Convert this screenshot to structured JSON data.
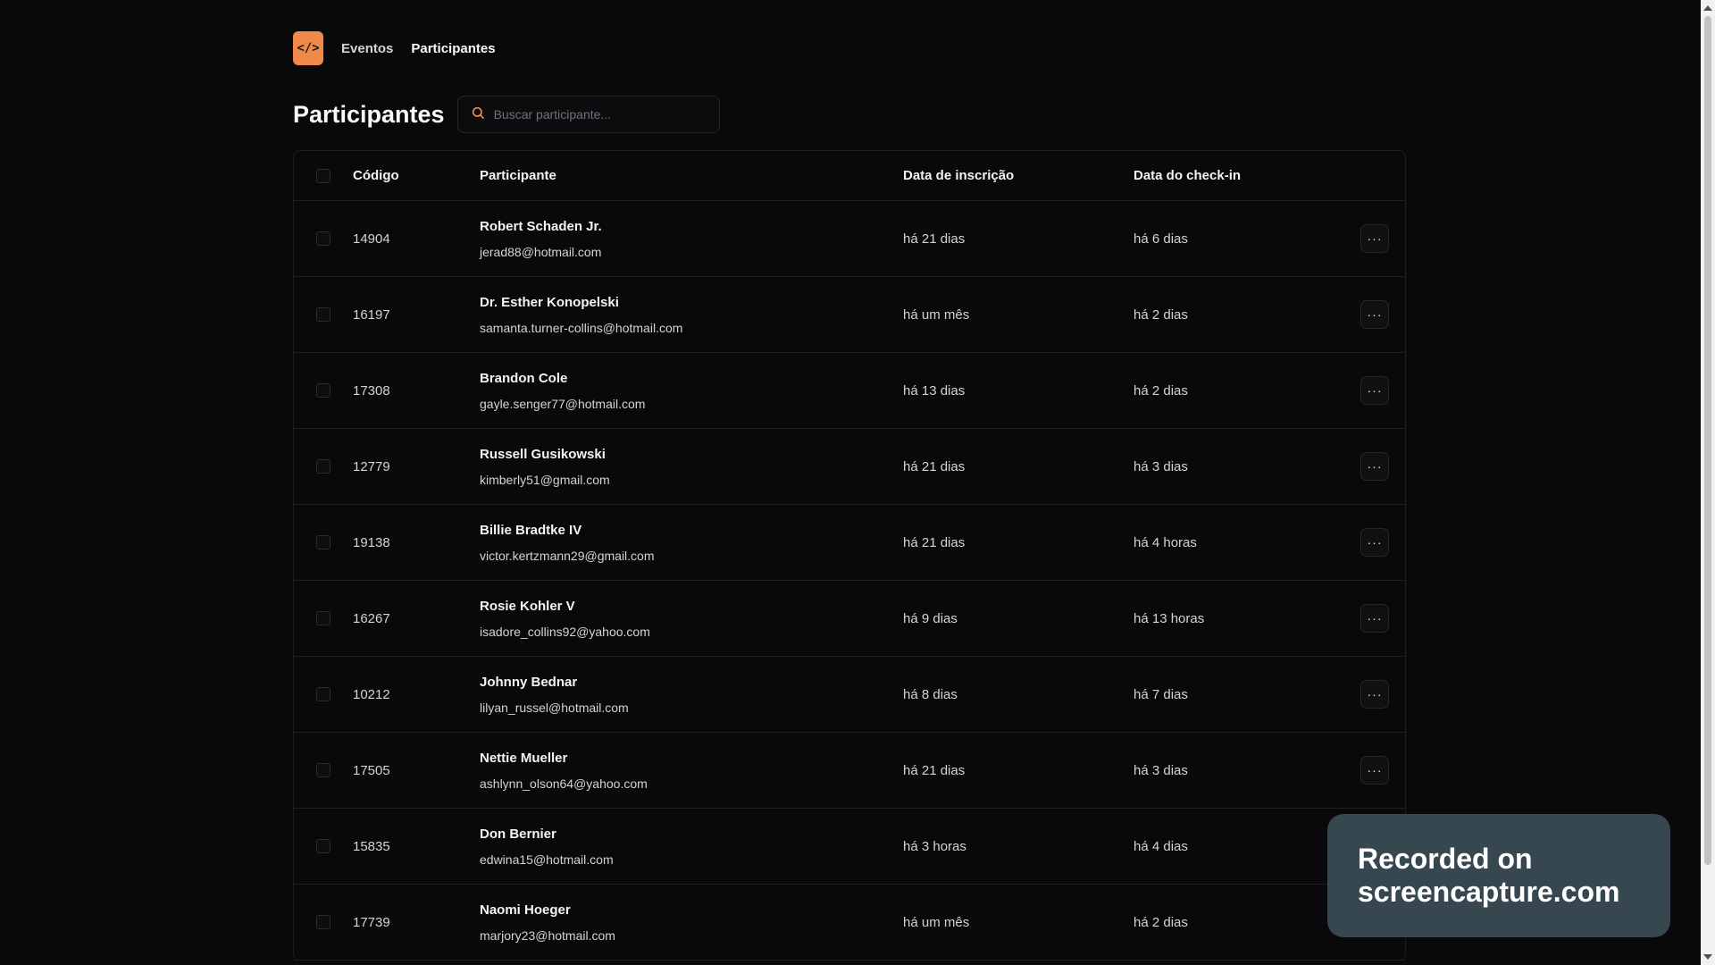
{
  "nav": {
    "logo_text": "</>",
    "items": [
      {
        "label": "Eventos"
      },
      {
        "label": "Participantes"
      }
    ]
  },
  "page": {
    "title": "Participantes",
    "search_placeholder": "Buscar participante..."
  },
  "table": {
    "headers": {
      "code": "Código",
      "participant": "Participante",
      "registration_date": "Data de inscrição",
      "checkin_date": "Data do check-in"
    },
    "rows": [
      {
        "code": "14904",
        "name": "Robert Schaden Jr.",
        "email": "jerad88@hotmail.com",
        "registered": "há 21 dias",
        "checkin": "há 6 dias"
      },
      {
        "code": "16197",
        "name": "Dr. Esther Konopelski",
        "email": "samanta.turner-collins@hotmail.com",
        "registered": "há um mês",
        "checkin": "há 2 dias"
      },
      {
        "code": "17308",
        "name": "Brandon Cole",
        "email": "gayle.senger77@hotmail.com",
        "registered": "há 13 dias",
        "checkin": "há 2 dias"
      },
      {
        "code": "12779",
        "name": "Russell Gusikowski",
        "email": "kimberly51@gmail.com",
        "registered": "há 21 dias",
        "checkin": "há 3 dias"
      },
      {
        "code": "19138",
        "name": "Billie Bradtke IV",
        "email": "victor.kertzmann29@gmail.com",
        "registered": "há 21 dias",
        "checkin": "há 4 horas"
      },
      {
        "code": "16267",
        "name": "Rosie Kohler V",
        "email": "isadore_collins92@yahoo.com",
        "registered": "há 9 dias",
        "checkin": "há 13 horas"
      },
      {
        "code": "10212",
        "name": "Johnny Bednar",
        "email": "lilyan_russel@hotmail.com",
        "registered": "há 8 dias",
        "checkin": "há 7 dias"
      },
      {
        "code": "17505",
        "name": "Nettie Mueller",
        "email": "ashlynn_olson64@yahoo.com",
        "registered": "há 21 dias",
        "checkin": "há 3 dias"
      },
      {
        "code": "15835",
        "name": "Don Bernier",
        "email": "edwina15@hotmail.com",
        "registered": "há 3 horas",
        "checkin": "há 4 dias"
      },
      {
        "code": "17739",
        "name": "Naomi Hoeger",
        "email": "marjory23@hotmail.com",
        "registered": "há um mês",
        "checkin": "há 2 dias"
      }
    ],
    "row_action_label": "···"
  },
  "overlay": {
    "line1": "Recorded on",
    "line2": "screencapture.com"
  },
  "colors": {
    "background": "#09090b",
    "accent": "#f08a4b",
    "border": "#1f1f23",
    "overlay": "#37474f"
  }
}
